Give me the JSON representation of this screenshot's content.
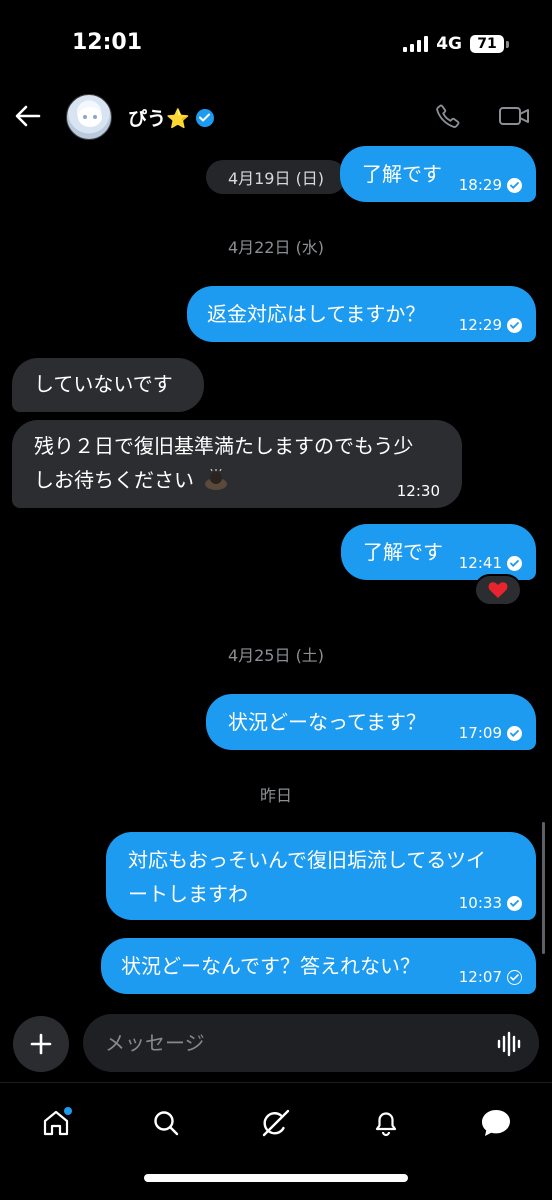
{
  "status_bar": {
    "time": "12:01",
    "network": "4G",
    "battery": "71"
  },
  "header": {
    "contact_name": "ぴう⭐️"
  },
  "messages": [
    {
      "text": "了解です",
      "time": "18:29"
    },
    {
      "date": "4月22日 (水)"
    },
    {
      "text": "返金対応はしてますか？",
      "time": "12:29"
    },
    {
      "text": "していないです"
    },
    {
      "text_line1": "残り２日で復旧基準満たしますのでもう少",
      "text_line2": "しお待ちください",
      "time": "12:30"
    },
    {
      "text": "了解です",
      "time": "12:41",
      "reaction": "❤️"
    },
    {
      "date": "4月25日 (土)"
    },
    {
      "text": "状況どーなってます？",
      "time": "17:09"
    },
    {
      "date": "昨日"
    },
    {
      "text_line1": "対応もおっそいんで復旧垢流してるツイ",
      "text_line2": "ートしますわ",
      "time": "10:33"
    },
    {
      "text": "状況どーなんです？答えれない？",
      "time": "12:07"
    }
  ],
  "floating_date": "4月19日 (日)",
  "composer": {
    "placeholder": "メッセージ"
  },
  "nav": [
    "home-icon",
    "search-icon",
    "grok-icon",
    "notifications-icon",
    "messages-icon"
  ],
  "colors": {
    "accent": "#1d9bf0",
    "incoming_bubble": "#2b2d30",
    "background": "#000000"
  }
}
